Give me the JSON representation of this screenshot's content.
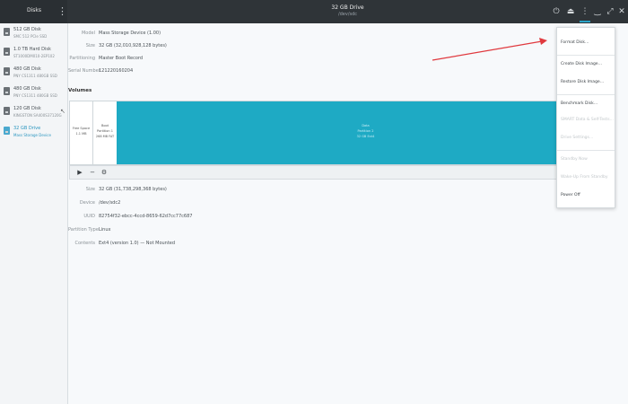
{
  "window": {
    "app_title": "Disks",
    "drive_title": "32 GB Drive",
    "drive_subtitle": "/dev/sdc"
  },
  "header_icons": [
    {
      "name": "power-icon",
      "glyph": "⏻"
    },
    {
      "name": "eject-icon",
      "glyph": "⏏"
    },
    {
      "name": "menu-icon",
      "glyph": "⋮"
    },
    {
      "name": "minimize-icon",
      "glyph": "‿"
    },
    {
      "name": "maximize-icon",
      "glyph": "⤢"
    },
    {
      "name": "close-icon",
      "glyph": "✕"
    }
  ],
  "sidebar": {
    "drives": [
      {
        "name": "512 GB Disk",
        "sub": "SMC 512 PCIe SSD"
      },
      {
        "name": "1.0 TB Hard Disk",
        "sub": "ST1000DM010-2EP102"
      },
      {
        "name": "480 GB Disk",
        "sub": "PNY CS1311 480GB SSD"
      },
      {
        "name": "480 GB Disk",
        "sub": "PNY CS1311 480GB SSD"
      },
      {
        "name": "120 GB Disk",
        "sub": "KINGSTON SA400S37120G"
      },
      {
        "name": "32 GB Drive",
        "sub": "Mass Storage Device",
        "selected": true
      }
    ]
  },
  "drive_info": [
    {
      "label": "Model",
      "value": "Mass Storage Device (1.00)"
    },
    {
      "label": "Size",
      "value": "32 GB (32,010,928,128 bytes)"
    },
    {
      "label": "Partitioning",
      "value": "Master Boot Record"
    },
    {
      "label": "Serial Number",
      "value": "121220160204"
    }
  ],
  "volumes": {
    "label": "Volumes",
    "segments": [
      {
        "line1": "Free Space",
        "line2": "1.1 MB"
      },
      {
        "line1": "Boot",
        "line2": "Partition 1",
        "line3": "268 MB FAT"
      },
      {
        "line1": "Data",
        "line2": "Partition 2",
        "line3": "32 GB Ext4"
      }
    ]
  },
  "volume_toolbar": {
    "play": "▶",
    "minus": "−",
    "gear": "⚙"
  },
  "volume_info": [
    {
      "label": "Size",
      "value": "32 GB (31,738,298,368 bytes)"
    },
    {
      "label": "Device",
      "value": "/dev/sdc2"
    },
    {
      "label": "UUID",
      "value": "82754f32-ebcc-4ccd-8659-62d7cc77c687"
    },
    {
      "label": "Partition Type",
      "value": "Linux"
    },
    {
      "label": "Contents",
      "value": "Ext4 (version 1.0) — Not Mounted"
    }
  ],
  "menu": {
    "items": [
      {
        "label": "Format Disk…",
        "disabled": false
      },
      {
        "label": "Create Disk Image…",
        "disabled": false
      },
      {
        "label": "Restore Disk Image…",
        "disabled": false
      },
      {
        "label": "Benchmark Disk…",
        "disabled": false
      },
      {
        "label": "SMART Data & Self-Tests…",
        "disabled": true
      },
      {
        "label": "Drive Settings…",
        "disabled": true
      },
      {
        "label": "Standby Now",
        "disabled": true
      },
      {
        "label": "Wake-Up From Standby",
        "disabled": true
      },
      {
        "label": "Power Off",
        "disabled": false
      }
    ]
  },
  "colors": {
    "accent": "#2aa3c7",
    "volume_fill": "#1eaac4",
    "arrow": "#e0393e"
  }
}
